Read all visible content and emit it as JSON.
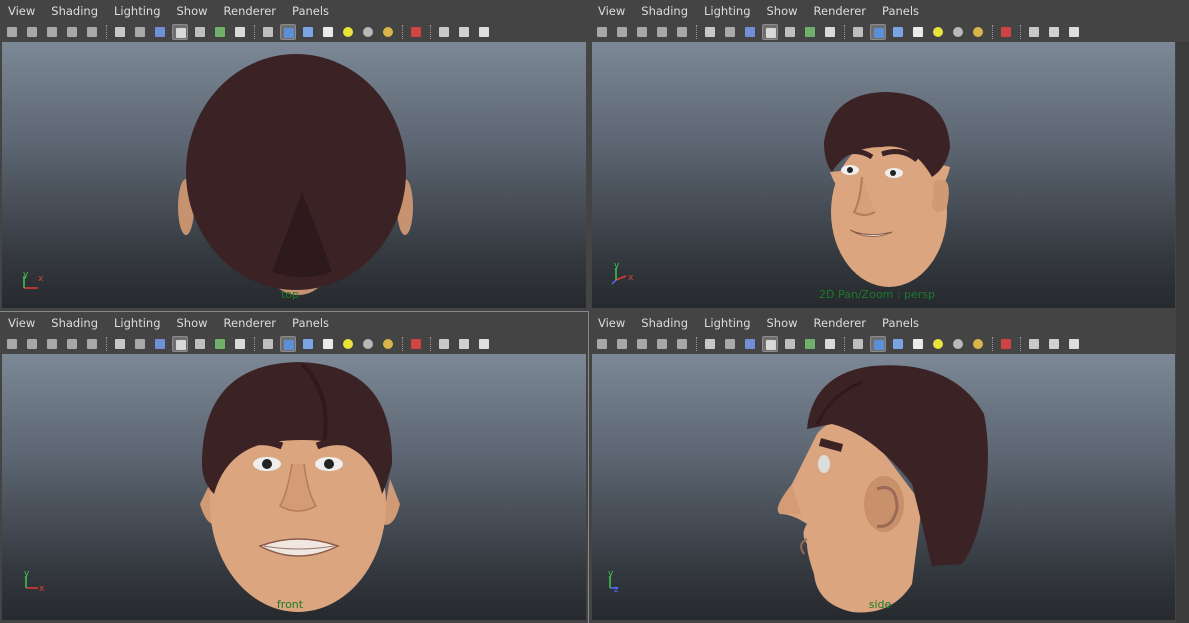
{
  "menu": [
    "View",
    "Shading",
    "Lighting",
    "Show",
    "Renderer",
    "Panels"
  ],
  "toolbar_icons": [
    "camera-attributes-icon",
    "bookmark-icon",
    "image-plane-icon",
    "grid-icon",
    "film-gate-icon",
    "sep",
    "wireframe-icon",
    "smooth-wire-icon",
    "smooth-shade-icon",
    "flat-shade-icon",
    "xray-icon",
    "xray-joints-icon",
    "text-icon",
    "sep",
    "isolate-icon",
    "shaded-box-icon",
    "textured-icon",
    "checker-icon",
    "default-light-icon",
    "all-lights-icon",
    "shadow-light-icon",
    "sep",
    "select-camera-icon",
    "sep",
    "backface-icon",
    "wireframe-on-shaded-icon",
    "hierarchy-icon"
  ],
  "panels": [
    {
      "id": "top",
      "label": "top"
    },
    {
      "id": "persp",
      "label": "2D Pan/Zoom : persp"
    },
    {
      "id": "front",
      "label": "front"
    },
    {
      "id": "side",
      "label": "side"
    }
  ],
  "axes": {
    "top": [
      "y",
      "x"
    ],
    "persp": [
      "y",
      "x"
    ],
    "front": [
      "y",
      "x"
    ],
    "side": [
      "y",
      "z"
    ]
  },
  "colors": {
    "skin": "#dba57f",
    "hair": "#3b2224",
    "axis_x": "#e03a3a",
    "axis_y": "#3fc84a",
    "axis_z": "#4b6bff",
    "label": "#1a7a2a"
  }
}
